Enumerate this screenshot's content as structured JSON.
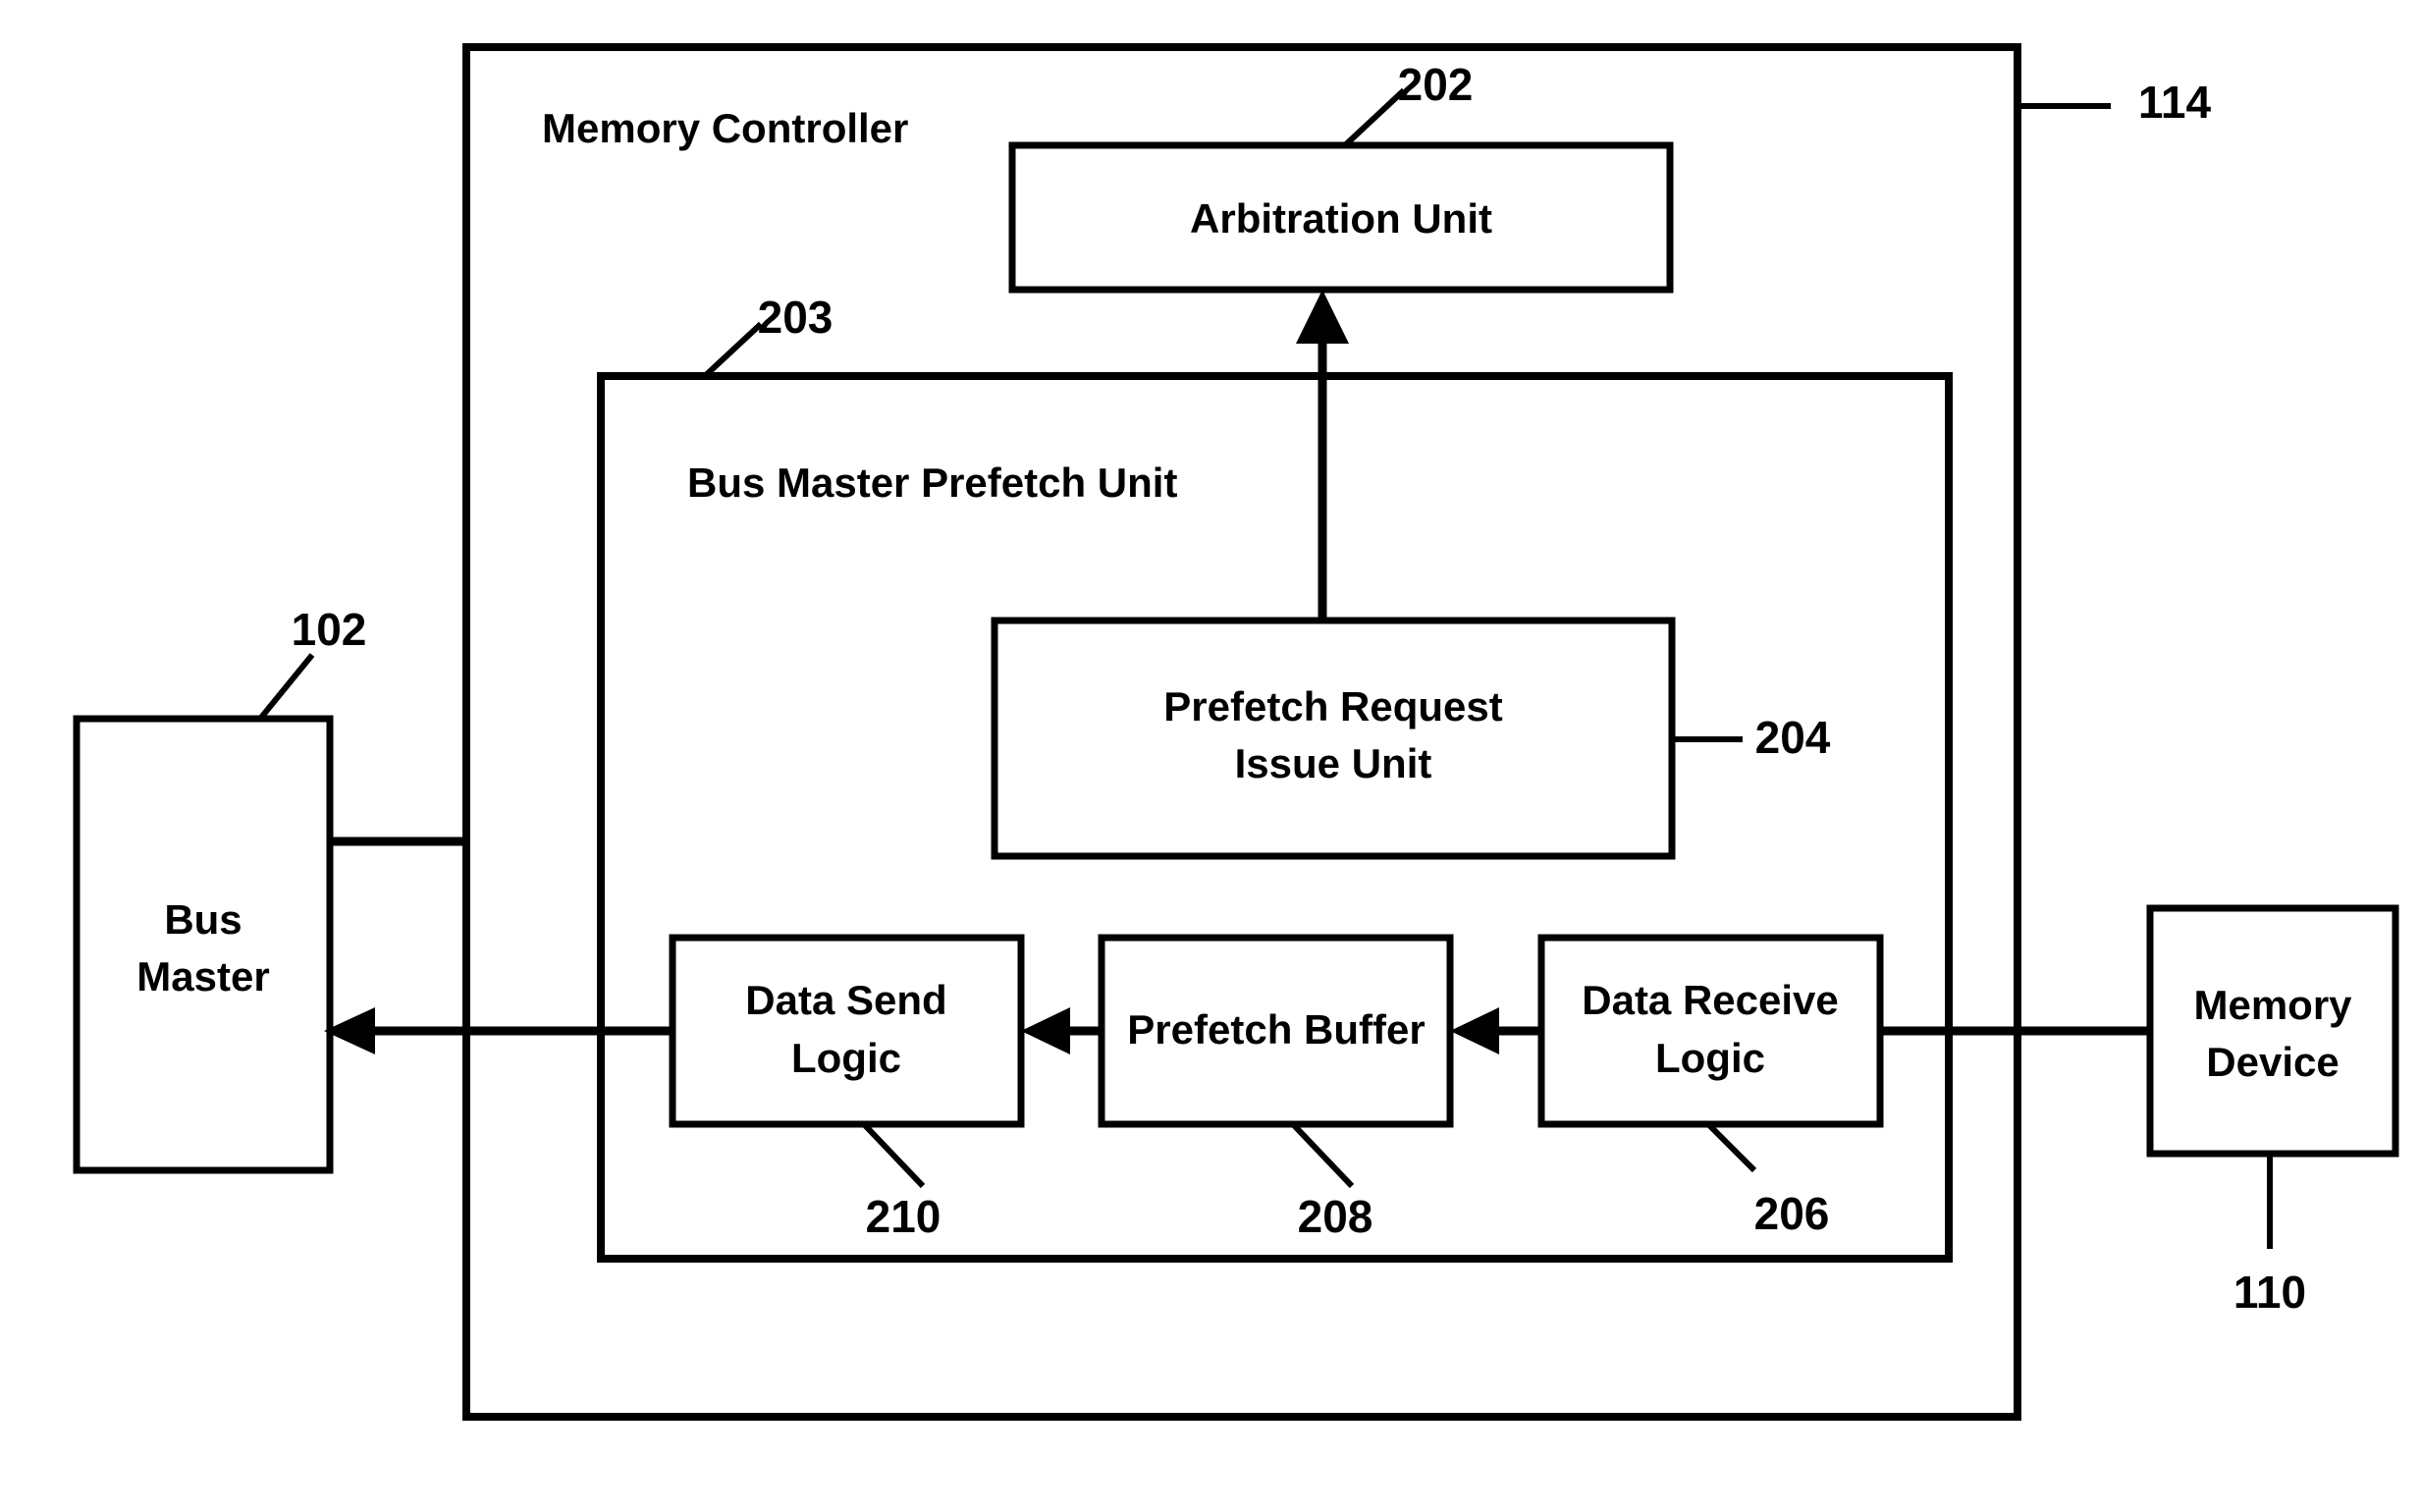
{
  "figure": {
    "type": "patent-block-diagram",
    "background_color": "#ffffff",
    "line_color": "#000000"
  },
  "containers": {
    "memory_controller": {
      "label": "Memory Controller",
      "ref": "114"
    },
    "bus_master_prefetch_unit": {
      "label": "Bus Master Prefetch Unit",
      "ref": "203"
    }
  },
  "blocks": {
    "bus_master": {
      "line1": "Bus",
      "line2": "Master",
      "ref": "102"
    },
    "arbitration_unit": {
      "label": "Arbitration Unit",
      "ref": "202"
    },
    "prefetch_request_issue_unit": {
      "line1": "Prefetch Request",
      "line2": "Issue Unit",
      "ref": "204"
    },
    "data_send_logic": {
      "line1": "Data Send",
      "line2": "Logic",
      "ref": "210"
    },
    "prefetch_buffer": {
      "label": "Prefetch Buffer",
      "ref": "208"
    },
    "data_receive_logic": {
      "line1": "Data Receive",
      "line2": "Logic",
      "ref": "206"
    },
    "memory_device": {
      "line1": "Memory",
      "line2": "Device",
      "ref": "110"
    }
  }
}
